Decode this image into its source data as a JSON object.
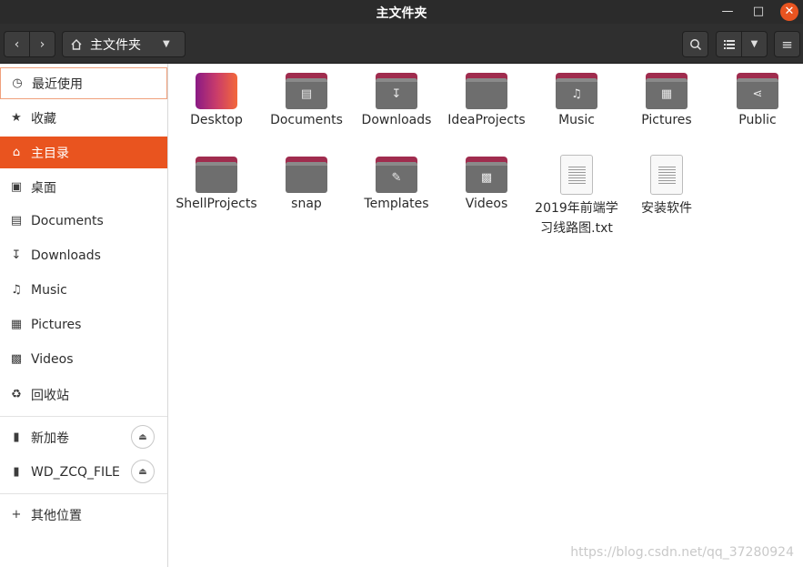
{
  "window": {
    "title": "主文件夹"
  },
  "toolbar": {
    "location": "主文件夹",
    "back_icon": "chevron-left-icon",
    "forward_icon": "chevron-right-icon",
    "home_icon": "home-icon",
    "search_icon": "search-icon",
    "view_icon": "list-view-icon",
    "menu_icon": "hamburger-icon"
  },
  "sidebar": {
    "recent": "最近使用",
    "starred": "收藏",
    "home": "主目录",
    "desktop": "桌面",
    "documents": "Documents",
    "downloads": "Downloads",
    "music": "Music",
    "pictures": "Pictures",
    "videos": "Videos",
    "trash": "回收站",
    "volume1": "新加卷",
    "volume2": "WD_ZCQ_FILE",
    "other": "其他位置"
  },
  "files": {
    "desktop": "Desktop",
    "documents": "Documents",
    "downloads": "Downloads",
    "ideaprojects": "IdeaProjects",
    "music": "Music",
    "pictures": "Pictures",
    "public": "Public",
    "shellprojects": "ShellProjects",
    "snap": "snap",
    "templates": "Templates",
    "videos": "Videos",
    "roadmap": "2019年前端学习线路图.txt",
    "install": "安装软件"
  },
  "watermark": "https://blog.csdn.net/qq_37280924",
  "colors": {
    "accent": "#e9541f",
    "titlebar": "#2b2b2b",
    "folder_tab": "#a02c4e",
    "folder_body": "#6e6e6e"
  }
}
